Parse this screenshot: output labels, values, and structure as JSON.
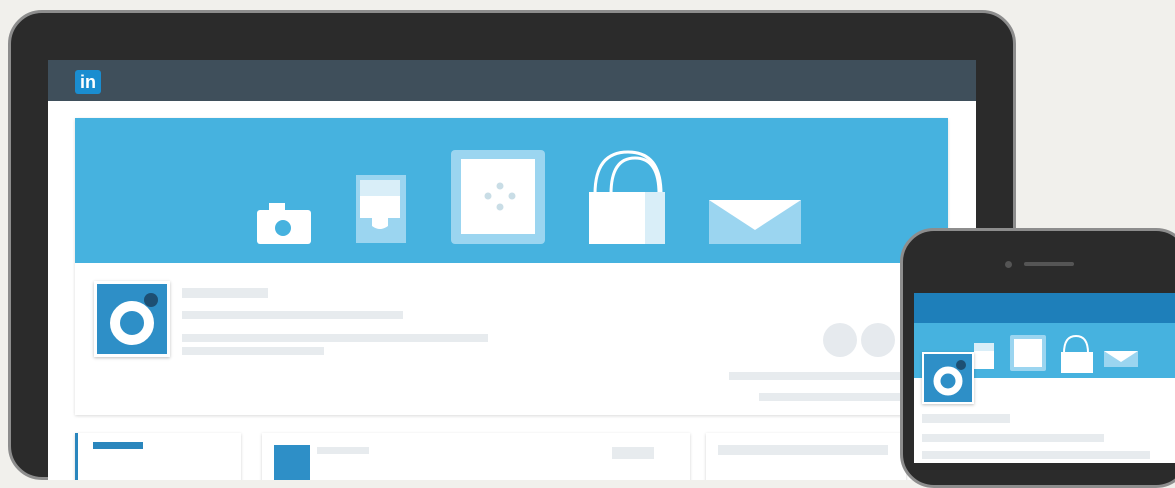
{
  "app": {
    "logo_text": "in",
    "logo_color": "#1a8dd0"
  },
  "colors": {
    "navbar": "#3f4f5b",
    "banner": "#46b2df",
    "accent": "#2a86bd",
    "placeholder": "#e7ebee",
    "page_bg": "#f1f0ec"
  },
  "icons": [
    "camera-icon",
    "cup-icon",
    "box-icon",
    "shopping-bag-icon",
    "envelope-icon"
  ],
  "profile": {
    "logo_icon": "company-logo-icon"
  }
}
